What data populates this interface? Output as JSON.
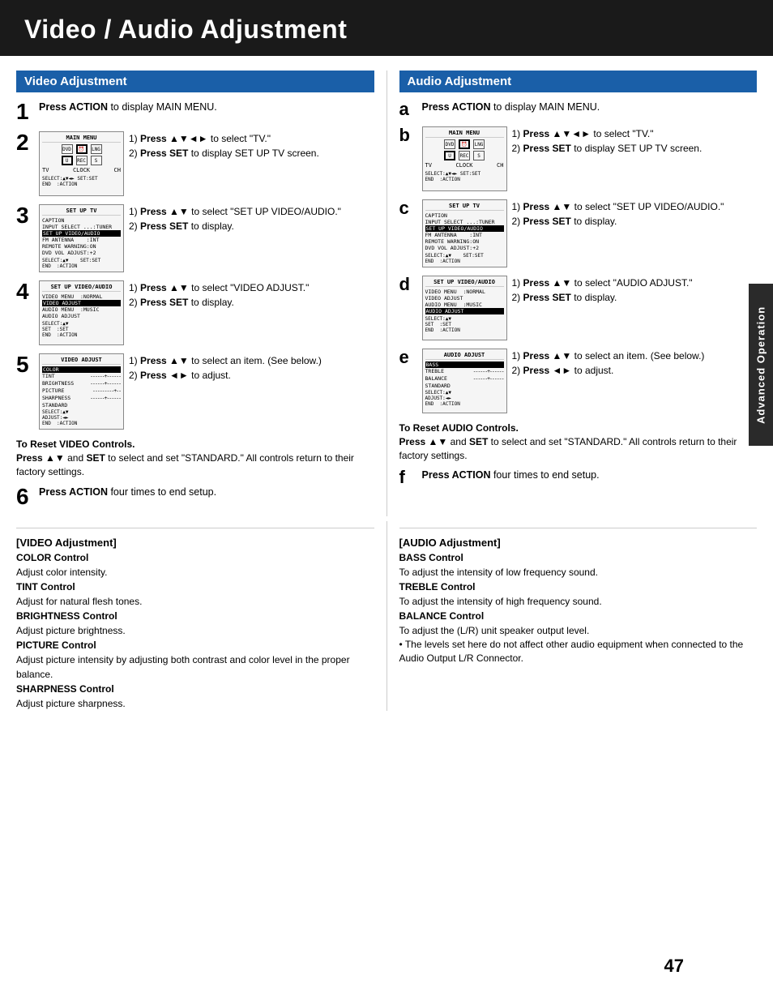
{
  "title": "Video / Audio Adjustment",
  "left_section_header": "Video Adjustment",
  "right_section_header": "Audio Adjustment",
  "steps_left": {
    "step1": {
      "number": "1",
      "text_bold": "Press ACTION",
      "text_rest": " to display MAIN MENU."
    },
    "step2": {
      "number": "2",
      "instructions": [
        {
          "num": "1",
          "text": "Press ▲▼◄► to select \"TV.\""
        },
        {
          "num": "2",
          "text_bold": "Press SET",
          "text_rest": " to display SET UP TV screen."
        }
      ]
    },
    "step3": {
      "number": "3",
      "instructions": [
        {
          "num": "1",
          "text": "Press ▲▼ to select \"SET UP VIDEO/AUDIO.\""
        },
        {
          "num": "2",
          "text_bold": "Press SET",
          "text_rest": " to display."
        }
      ]
    },
    "step4": {
      "number": "4",
      "instructions": [
        {
          "num": "1",
          "text": "Press ▲▼ to select \"VIDEO ADJUST.\""
        },
        {
          "num": "2",
          "text_bold": "Press SET",
          "text_rest": " to display."
        }
      ]
    },
    "step5": {
      "number": "5",
      "instructions": [
        {
          "num": "1",
          "text": "Press ▲▼ to select an item. (See below.)"
        },
        {
          "num": "2",
          "text": "Press ◄► to adjust."
        }
      ]
    },
    "step6": {
      "number": "6",
      "text_bold": "Press ACTION",
      "text_rest": " four times to end setup."
    }
  },
  "steps_right": {
    "stepa": {
      "number": "a",
      "text_bold": "Press ACTION",
      "text_rest": " to display MAIN MENU."
    },
    "stepb": {
      "number": "b",
      "instructions": [
        {
          "num": "1",
          "text": "Press ▲▼◄► to select \"TV.\""
        },
        {
          "num": "2",
          "text_bold": "Press SET",
          "text_rest": " to display SET UP TV screen."
        }
      ]
    },
    "stepc": {
      "number": "c",
      "instructions": [
        {
          "num": "1",
          "text": "Press ▲▼ to select \"SET UP VIDEO/AUDIO.\""
        },
        {
          "num": "2",
          "text_bold": "Press SET",
          "text_rest": " to display."
        }
      ]
    },
    "stepd": {
      "number": "d",
      "instructions": [
        {
          "num": "1",
          "text": "Press ▲▼ to select \"AUDIO ADJUST.\""
        },
        {
          "num": "2",
          "text_bold": "Press SET",
          "text_rest": " to display."
        }
      ]
    },
    "stepe": {
      "number": "e",
      "instructions": [
        {
          "num": "1",
          "text": "Press ▲▼ to select an item. (See below.)"
        },
        {
          "num": "2",
          "text": "Press ◄► to adjust."
        }
      ]
    },
    "stepf": {
      "number": "f",
      "text_bold": "Press ACTION",
      "text_rest": " four times to end setup."
    }
  },
  "reset_left": {
    "title": "To Reset VIDEO Controls.",
    "text": "Press ▲▼ and SET to select and set \"STANDARD.\" All controls return to their factory settings."
  },
  "reset_right": {
    "title": "To Reset AUDIO Controls.",
    "text": "Press ▲▼ and SET to select and set \"STANDARD.\" All controls return to their factory settings."
  },
  "controls_left": {
    "title": "[VIDEO Adjustment]",
    "items": [
      {
        "name": "COLOR Control",
        "desc": "Adjust color intensity."
      },
      {
        "name": "TINT Control",
        "desc": "Adjust for natural flesh tones."
      },
      {
        "name": "BRIGHTNESS Control",
        "desc": "Adjust picture brightness."
      },
      {
        "name": "PICTURE Control",
        "desc": "Adjust picture intensity by adjusting both contrast and color level in the proper balance."
      },
      {
        "name": "SHARPNESS Control",
        "desc": "Adjust picture sharpness."
      }
    ]
  },
  "controls_right": {
    "title": "[AUDIO Adjustment]",
    "items": [
      {
        "name": "BASS Control",
        "desc": "To adjust the intensity of low frequency sound."
      },
      {
        "name": "TREBLE Control",
        "desc": "To adjust the intensity of high frequency sound."
      },
      {
        "name": "BALANCE Control",
        "desc": "To adjust the (L/R) unit speaker output level."
      }
    ],
    "note": "The levels set here do not affect other audio equipment when connected to the Audio Output L/R Connector."
  },
  "page_number": "47",
  "side_tab_text": "Advanced Operation"
}
